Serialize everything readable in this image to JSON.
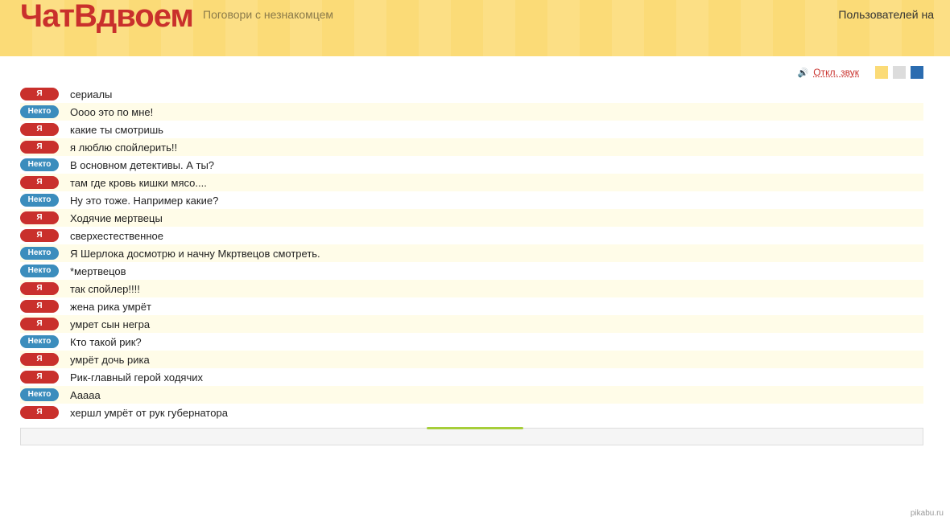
{
  "header": {
    "logo": "ЧатВдвоем",
    "tagline": "Поговори с незнакомцем",
    "users_label": "Пользователей на"
  },
  "controls": {
    "sound_toggle": "Откл. звук",
    "swatches": [
      "#fbdb77",
      "#dcdcdc",
      "#2b6cb0"
    ]
  },
  "labels": {
    "me": "Я",
    "other": "Некто"
  },
  "messages": [
    {
      "who": "me",
      "text": "сериалы"
    },
    {
      "who": "other",
      "text": "Оооо это по мне!"
    },
    {
      "who": "me",
      "text": "какие ты смотришь"
    },
    {
      "who": "me",
      "text": "я люблю спойлерить!!"
    },
    {
      "who": "other",
      "text": "В основном детективы. А ты?"
    },
    {
      "who": "me",
      "text": "там где кровь кишки мясо...."
    },
    {
      "who": "other",
      "text": "Ну это тоже. Например какие?"
    },
    {
      "who": "me",
      "text": "Ходячие мертвецы"
    },
    {
      "who": "me",
      "text": "сверхестественное"
    },
    {
      "who": "other",
      "text": "Я Шерлока досмотрю и начну Мкртвецов смотреть."
    },
    {
      "who": "other",
      "text": "*мертвецов"
    },
    {
      "who": "me",
      "text": "так спойлер!!!!"
    },
    {
      "who": "me",
      "text": "жена рика умрёт"
    },
    {
      "who": "me",
      "text": "умрет сын негра"
    },
    {
      "who": "other",
      "text": "Кто такой рик?"
    },
    {
      "who": "me",
      "text": "умрёт дочь рика"
    },
    {
      "who": "me",
      "text": "Рик-главный герой ходячих"
    },
    {
      "who": "other",
      "text": "Ааааа"
    },
    {
      "who": "me",
      "text": "хершл умрёт от рук губернатора"
    }
  ],
  "watermark": "pikabu.ru"
}
